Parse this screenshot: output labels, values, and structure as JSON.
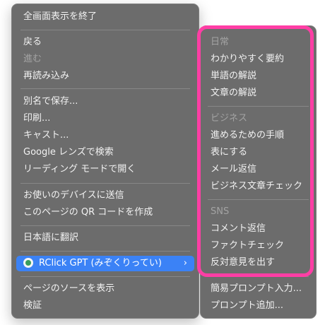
{
  "menu": {
    "exit_fullscreen": "全画面表示を終了",
    "back": "戻る",
    "forward": "進む",
    "reload": "再読み込み",
    "save_as": "別名で保存...",
    "print": "印刷...",
    "cast": "キャスト...",
    "google_lens": "Google レンズで検索",
    "reading_mode": "リーディング モードで開く",
    "send_to_devices": "お使いのデバイスに送信",
    "qr_code": "このページの QR コードを作成",
    "translate": "日本語に翻訳",
    "extension": "RClick GPT (みぞくりってい)",
    "view_source": "ページのソースを表示",
    "inspect": "検証"
  },
  "submenu": {
    "group_daily": "日常",
    "summarize": "わかりやすく要約",
    "word_explain": "単語の解説",
    "sentence_explain": "文章の解説",
    "group_business": "ビジネス",
    "steps": "進めるための手順",
    "make_table": "表にする",
    "mail_reply": "メール返信",
    "business_check": "ビジネス文章チェック",
    "group_sns": "SNS",
    "comment_reply": "コメント返信",
    "fact_check": "ファクトチェック",
    "counter_opinion": "反対意見を出す",
    "simple_prompt": "簡易プロンプト入力...",
    "add_prompt": "プロンプト追加..."
  },
  "icons": {
    "submenu_arrow": "›",
    "extension_icon": "rclick-gpt-icon"
  },
  "colors": {
    "highlight": "#3b82f6",
    "annotation_frame": "#ff3ea5"
  }
}
